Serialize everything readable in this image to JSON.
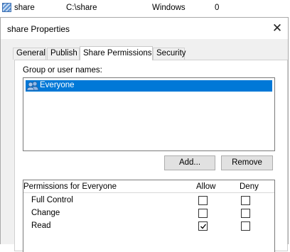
{
  "background_row": {
    "name": "share",
    "path": "C:\\share",
    "type": "Windows",
    "count": "0"
  },
  "dialog": {
    "title": "share Properties",
    "close_glyph": "✕",
    "tabs": [
      {
        "label": "General",
        "active": false
      },
      {
        "label": "Publish",
        "active": false
      },
      {
        "label": "Share Permissions",
        "active": true
      },
      {
        "label": "Security",
        "active": false
      }
    ],
    "group_label": "Group or user names:",
    "users": [
      {
        "name": "Everyone",
        "icon": "users-icon",
        "selected": true
      }
    ],
    "buttons": {
      "add": "Add...",
      "remove": "Remove"
    },
    "permissions": {
      "header": "Permissions for Everyone",
      "allow_label": "Allow",
      "deny_label": "Deny",
      "rows": [
        {
          "name": "Full Control",
          "allow": false,
          "deny": false
        },
        {
          "name": "Change",
          "allow": false,
          "deny": false
        },
        {
          "name": "Read",
          "allow": true,
          "deny": false
        }
      ]
    },
    "colors": {
      "selection": "#0078d7",
      "dialog_bg": "#f0f0f0"
    }
  }
}
